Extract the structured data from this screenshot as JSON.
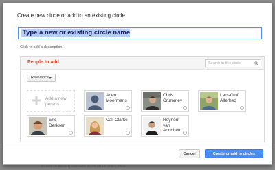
{
  "dialog": {
    "title": "Create new circle or add to an existing circle",
    "name_input_placeholder": "Type a new or existing circle name",
    "description_link": "Click to add a description."
  },
  "people_panel": {
    "heading": "People to add",
    "search_placeholder": "Search in this circle",
    "sort_label": "Relevance",
    "add_person_label": "Add a new\nperson",
    "people": [
      {
        "name": "Arjen\nMoermans"
      },
      {
        "name": "Chris\nCrummey"
      },
      {
        "name": "Lars-Olof\nAllerhed"
      },
      {
        "name": "Eric\nDerksen"
      },
      {
        "name": "Cali Clarke"
      },
      {
        "name": "Reynout\nvan\nAdrichem"
      }
    ]
  },
  "buttons": {
    "cancel": "Cancel",
    "submit": "Create or add to circles"
  },
  "colors": {
    "heading_red": "#dd4b39",
    "primary_blue": "#4d90fe",
    "input_focus": "#4d90fe"
  },
  "icons": {
    "search": "magnifier-icon",
    "add": "plus-icon",
    "sort": "caret-down-icon"
  }
}
